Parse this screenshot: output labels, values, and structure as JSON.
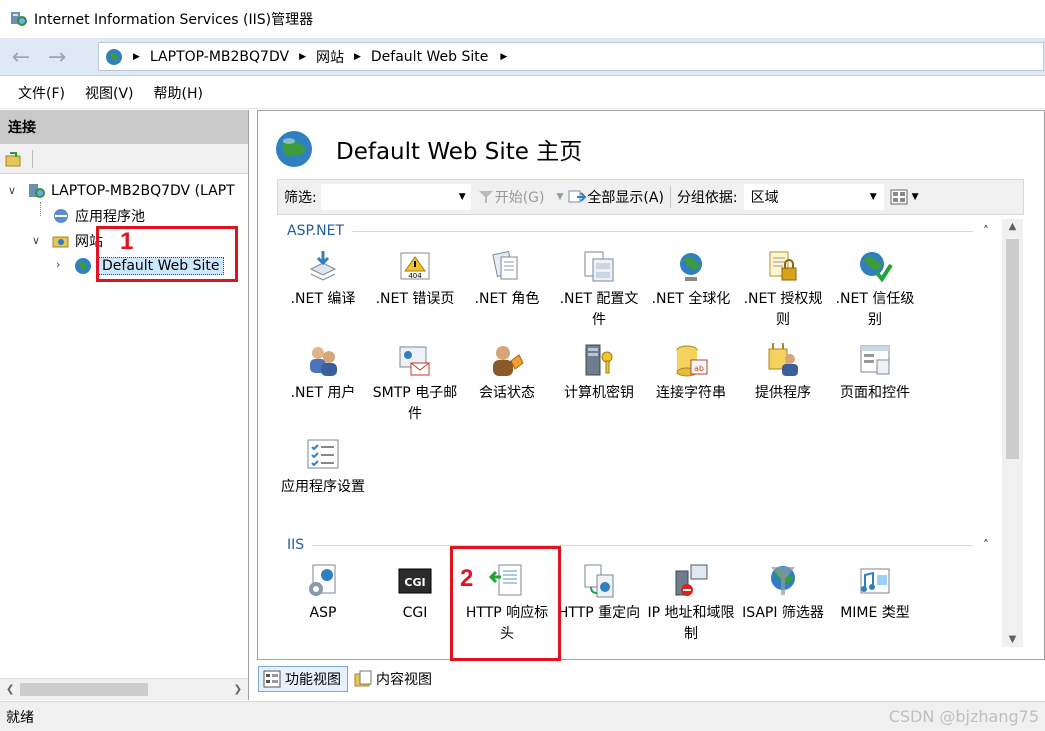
{
  "window": {
    "title": "Internet Information Services (IIS)管理器"
  },
  "address": {
    "crumbs": [
      "LAPTOP-MB2BQ7DV",
      "网站",
      "Default Web Site"
    ]
  },
  "menu": {
    "items": [
      "文件(F)",
      "视图(V)",
      "帮助(H)"
    ]
  },
  "connections": {
    "header": "连接",
    "tree": {
      "server": "LAPTOP-MB2BQ7DV (LAPT",
      "app_pools": "应用程序池",
      "sites": "网站",
      "site": "Default Web Site"
    }
  },
  "main": {
    "title": "Default Web Site 主页",
    "filter": {
      "label": "筛选:",
      "start": "开始(G)",
      "show_all": "全部显示(A)",
      "group_by_label": "分组依据:",
      "group_by_value": "区域"
    },
    "groups": [
      {
        "name": "ASP.NET",
        "features": [
          {
            "label": ".NET 编译"
          },
          {
            "label": ".NET 错误页"
          },
          {
            "label": ".NET 角色"
          },
          {
            "label": ".NET 配置文件"
          },
          {
            "label": ".NET 全球化"
          },
          {
            "label": ".NET 授权规则"
          },
          {
            "label": ".NET 信任级别"
          },
          {
            "label": ".NET 用户"
          },
          {
            "label": "SMTP 电子邮件"
          },
          {
            "label": "会话状态"
          },
          {
            "label": "计算机密钥"
          },
          {
            "label": "连接字符串"
          },
          {
            "label": "提供程序"
          },
          {
            "label": "页面和控件"
          },
          {
            "label": "应用程序设置"
          }
        ]
      },
      {
        "name": "IIS",
        "features": [
          {
            "label": "ASP"
          },
          {
            "label": "CGI"
          },
          {
            "label": "HTTP 响应标头"
          },
          {
            "label": "HTTP 重定向"
          },
          {
            "label": "IP 地址和域限制"
          },
          {
            "label": "ISAPI 筛选器"
          },
          {
            "label": "MIME 类型"
          }
        ]
      }
    ],
    "error_page_badge": "404",
    "cgi_badge": "CGI"
  },
  "view_tabs": {
    "features": "功能视图",
    "content": "内容视图"
  },
  "status": {
    "text": "就绪"
  },
  "watermark": "CSDN @bjzhang75",
  "annotations": {
    "one": "1",
    "two": "2"
  },
  "colors": {
    "annotation_red": "#e0141e",
    "group_blue": "#1f5d9b",
    "selection": "#cce8ff"
  }
}
